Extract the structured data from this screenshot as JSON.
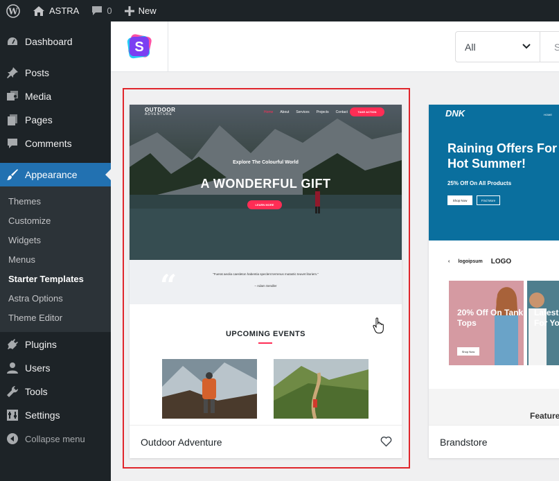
{
  "admin_bar": {
    "site_name": "ASTRA",
    "comments_count": "0",
    "new_label": "New"
  },
  "sidebar": {
    "items": [
      {
        "label": "Dashboard",
        "icon": "dashboard-icon"
      },
      {
        "label": "Posts",
        "icon": "pin-icon"
      },
      {
        "label": "Media",
        "icon": "media-icon"
      },
      {
        "label": "Pages",
        "icon": "pages-icon"
      },
      {
        "label": "Comments",
        "icon": "comment-icon"
      },
      {
        "label": "Appearance",
        "icon": "paintbrush-icon",
        "active": true
      },
      {
        "label": "Plugins",
        "icon": "plug-icon"
      },
      {
        "label": "Users",
        "icon": "users-icon"
      },
      {
        "label": "Tools",
        "icon": "wrench-icon"
      },
      {
        "label": "Settings",
        "icon": "settings-icon"
      }
    ],
    "submenu": [
      {
        "label": "Themes"
      },
      {
        "label": "Customize"
      },
      {
        "label": "Widgets"
      },
      {
        "label": "Menus"
      },
      {
        "label": "Starter Templates",
        "current": true
      },
      {
        "label": "Astra Options"
      },
      {
        "label": "Theme Editor"
      }
    ],
    "collapse_label": "Collapse menu"
  },
  "toolbar": {
    "filter_value": "All",
    "search_placeholder": "S"
  },
  "templates": [
    {
      "name": "Outdoor Adventure",
      "preview": {
        "logo": "OUTDOOR",
        "logo_sub": "ADVENTURE",
        "nav": [
          "Home",
          "About",
          "Services",
          "Projects",
          "Contact"
        ],
        "cta": "TAKE ACTION",
        "kicker": "Explore The Colourful World",
        "title": "A WONDERFUL GIFT",
        "button": "LEARN MORE",
        "quote": "\"Fuerat aeolia caesleton habentia speclent terrenus mutastic teuvet litoriem.\"",
        "quote_author": "– Adam Sendler",
        "section_title": "UPCOMING EVENTS"
      }
    },
    {
      "name": "Brandstore",
      "preview": {
        "logo": "DNK",
        "nav": "HOME",
        "title": "Raining Offers For Hot Summer!",
        "subtitle": "25% Off On All Products",
        "btn_shop": "Shop Now",
        "btn_more": "Find More",
        "brands": [
          "logoipsum",
          "LOGO"
        ],
        "promo_title": "20% Off On Tank Tops",
        "promo_btn": "Shop Now",
        "promo2_title": "Latest For Yo",
        "featured": "Feature"
      }
    }
  ],
  "colors": {
    "admin_dark": "#1d2327",
    "active_blue": "#2271b1",
    "highlight_red": "#e0252b",
    "accent_pink": "#ff2d55",
    "brandstore_blue": "#0a6f9e"
  }
}
